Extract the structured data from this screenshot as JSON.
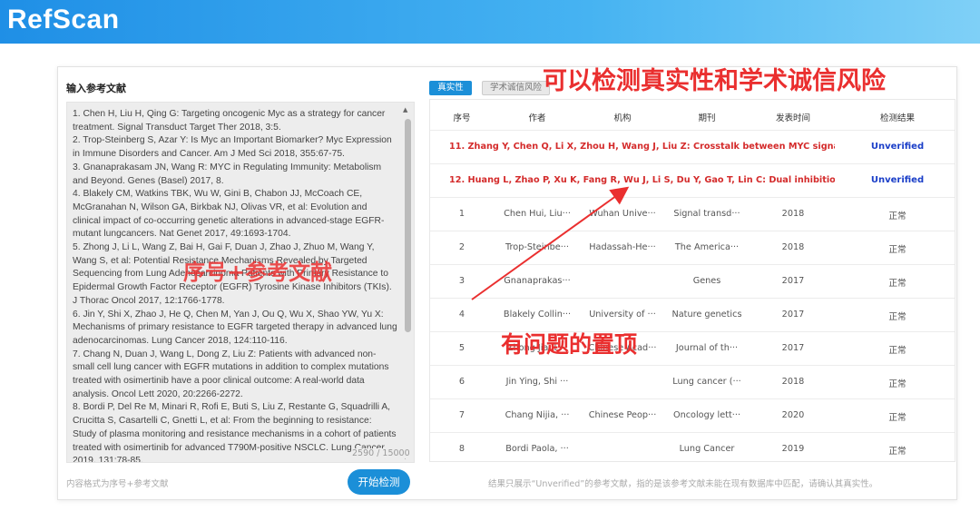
{
  "app": {
    "logo": "RefScan"
  },
  "input_panel": {
    "title": "输入参考文献",
    "references_text": "1. Chen H, Liu H, Qing G: Targeting oncogenic Myc as a strategy for cancer treatment. Signal Transduct Target Ther 2018, 3:5.\n2. Trop-Steinberg S, Azar Y: Is Myc an Important Biomarker? Myc Expression in Immune Disorders and Cancer. Am J Med Sci 2018, 355:67-75.\n3. Gnanaprakasam JN, Wang R: MYC in Regulating Immunity: Metabolism and Beyond. Genes (Basel) 2017, 8.\n4. Blakely CM, Watkins TBK, Wu W, Gini B, Chabon JJ, McCoach CE, McGranahan N, Wilson GA, Birkbak NJ, Olivas VR, et al: Evolution and clinical impact of co-occurring genetic alterations in advanced-stage EGFR-mutant lungcancers. Nat Genet 2017, 49:1693-1704.\n5. Zhong J, Li L, Wang Z, Bai H, Gai F, Duan J, Zhao J, Zhuo M, Wang Y, Wang S, et al: Potential Resistance Mechanisms Revealed by Targeted Sequencing from Lung Adenocarcinoma Patients with Primary Resistance to Epidermal Growth Factor Receptor (EGFR) Tyrosine Kinase Inhibitors (TKIs). J Thorac Oncol 2017, 12:1766-1778.\n6. Jin Y, Shi X, Zhao J, He Q, Chen M, Yan J, Ou Q, Wu X, Shao YW, Yu X: Mechanisms of primary resistance to EGFR targeted therapy in advanced lung adenocarcinomas. Lung Cancer 2018, 124:110-116.\n7. Chang N, Duan J, Wang L, Dong Z, Liu Z: Patients with advanced non-small cell lung cancer with EGFR mutations in addition to complex mutations treated with osimertinib have a poor clinical outcome: A real-world data analysis. Oncol Lett 2020, 20:2266-2272.\n8. Bordi P, Del Re M, Minari R, Rofi E, Buti S, Liu Z, Restante G, Squadrilli A, Crucitta S, Casartelli C, Gnetti L, et al: From the beginning to resistance: Study of plasma monitoring and resistance mechanisms in a cohort of patients treated with osimertinib for advanced T790M-positive NSCLC. Lung Cancer 2019, 131:78-85.",
    "char_count": "2590 / 15000",
    "hint": "内容格式为序号+参考文献",
    "start_button": "开始检测"
  },
  "result_panel": {
    "tabs": [
      {
        "label": "真实性",
        "active": true
      },
      {
        "label": "学术诚信风险",
        "active": false
      }
    ],
    "headers": [
      "序号",
      "作者",
      "机构",
      "期刊",
      "发表时间",
      "检测结果"
    ],
    "flagged_rows": [
      {
        "text": "11. Zhang Y, Chen Q, Li X, Zhou H, Wang J, Liu Z: Crosstalk between MYC signaling and ···",
        "status": "Unverified"
      },
      {
        "text": "12. Huang L, Zhao P, Xu K, Fang R, Wu J, Li S, Du Y, Gao T, Lin C: Dual inhibition of MYC ···",
        "status": "Unverified"
      }
    ],
    "rows": [
      {
        "no": "1",
        "author": "Chen Hui, Liu···",
        "institution": "Wuhan Unive···",
        "journal": "Signal transd···",
        "year": "2018",
        "result": "正常"
      },
      {
        "no": "2",
        "author": "Trop-Steinbe···",
        "institution": "Hadassah-He···",
        "journal": "The America···",
        "year": "2018",
        "result": "正常"
      },
      {
        "no": "3",
        "author": "Gnanaprakas···",
        "institution": "",
        "journal": "Genes",
        "year": "2017",
        "result": "正常"
      },
      {
        "no": "4",
        "author": "Blakely Collin···",
        "institution": "University of ···",
        "journal": "Nature genetics",
        "year": "2017",
        "result": "正常"
      },
      {
        "no": "5",
        "author": "Zhong Jia, L···",
        "institution": "Chinese Acad···",
        "journal": "Journal of th···",
        "year": "2017",
        "result": "正常"
      },
      {
        "no": "6",
        "author": "Jin Ying, Shi ···",
        "institution": "",
        "journal": "Lung cancer (···",
        "year": "2018",
        "result": "正常"
      },
      {
        "no": "7",
        "author": "Chang Nijia, ···",
        "institution": "Chinese Peop···",
        "journal": "Oncology lett···",
        "year": "2020",
        "result": "正常"
      },
      {
        "no": "8",
        "author": "Bordi Paola, ···",
        "institution": "",
        "journal": "Lung Cancer",
        "year": "2019",
        "result": "正常"
      }
    ],
    "footer_note": "结果只展示“Unverified”的参考文献，指的是该参考文献未能在现有数据库中匹配，请确认其真实性。"
  },
  "annotations": {
    "top": "可以检测真实性和学术诚信风险",
    "middle": "有问题的置顶",
    "left": "序号+参考文献"
  },
  "colors": {
    "accent": "#1b8fd8",
    "flag_red": "#d42b2b",
    "unverified_blue": "#1a3ec8",
    "annotation_red": "#ea2f2f"
  }
}
